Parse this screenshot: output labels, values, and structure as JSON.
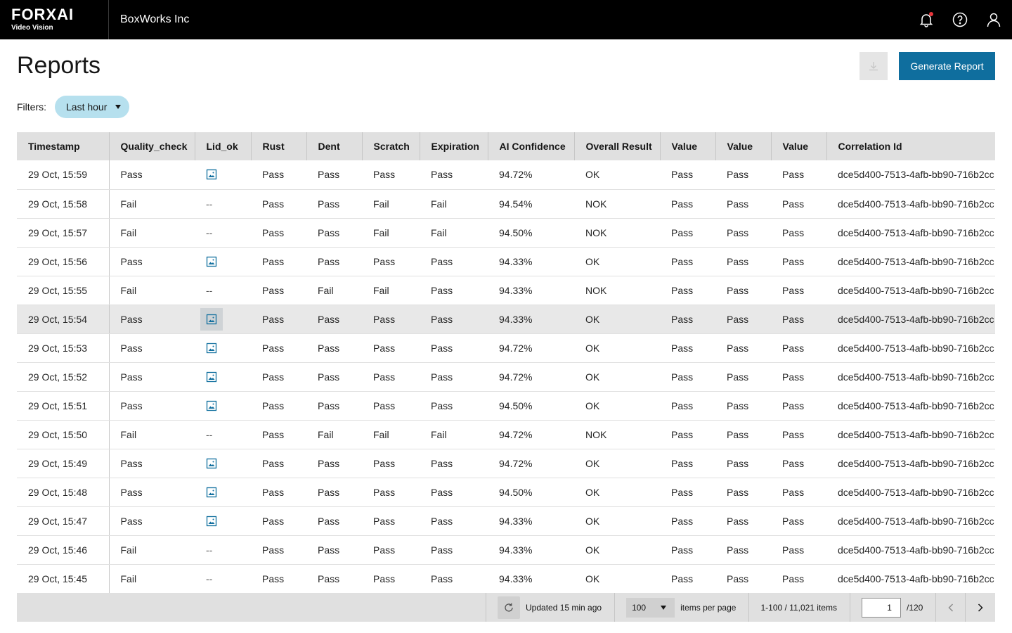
{
  "header": {
    "brand_name": "FORXAI",
    "brand_sub": "Video Vision",
    "company": "BoxWorks Inc",
    "icons": [
      "bell-icon",
      "help-icon",
      "user-icon"
    ]
  },
  "page": {
    "title": "Reports",
    "generate_label": "Generate Report",
    "download_icon": "download-icon"
  },
  "filters": {
    "label": "Filters:",
    "chip_label": "Last hour"
  },
  "colors": {
    "primary": "#0f6e9e",
    "chip": "#b6e0ee",
    "header_bg": "#000000",
    "notification": "#e8353b"
  },
  "table": {
    "columns": [
      "Timestamp",
      "Quality_check",
      "Lid_ok",
      "Rust",
      "Dent",
      "Scratch",
      "Expiration",
      "AI Confidence",
      "Overall Result",
      "Value",
      "Value",
      "Value",
      "Correlation Id"
    ],
    "rows": [
      {
        "ts": "29 Oct, 15:59",
        "qc": "Pass",
        "lid": "image",
        "rust": "Pass",
        "dent": "Pass",
        "scratch": "Pass",
        "exp": "Pass",
        "ai": "94.72%",
        "overall": "OK",
        "v1": "Pass",
        "v2": "Pass",
        "v3": "Pass",
        "cid": "dce5d400-7513-4afb-bb90-716b2cc"
      },
      {
        "ts": "29 Oct, 15:58",
        "qc": "Fail",
        "lid": "--",
        "rust": "Pass",
        "dent": "Pass",
        "scratch": "Fail",
        "exp": "Fail",
        "ai": "94.54%",
        "overall": "NOK",
        "v1": "Pass",
        "v2": "Pass",
        "v3": "Pass",
        "cid": "dce5d400-7513-4afb-bb90-716b2cc"
      },
      {
        "ts": "29 Oct, 15:57",
        "qc": "Fail",
        "lid": "--",
        "rust": "Pass",
        "dent": "Pass",
        "scratch": "Fail",
        "exp": "Fail",
        "ai": "94.50%",
        "overall": "NOK",
        "v1": "Pass",
        "v2": "Pass",
        "v3": "Pass",
        "cid": "dce5d400-7513-4afb-bb90-716b2cc"
      },
      {
        "ts": "29 Oct, 15:56",
        "qc": "Pass",
        "lid": "image",
        "rust": "Pass",
        "dent": "Pass",
        "scratch": "Pass",
        "exp": "Pass",
        "ai": "94.33%",
        "overall": "OK",
        "v1": "Pass",
        "v2": "Pass",
        "v3": "Pass",
        "cid": "dce5d400-7513-4afb-bb90-716b2cc"
      },
      {
        "ts": "29 Oct, 15:55",
        "qc": "Fail",
        "lid": "--",
        "rust": "Pass",
        "dent": "Fail",
        "scratch": "Fail",
        "exp": "Pass",
        "ai": "94.33%",
        "overall": "NOK",
        "v1": "Pass",
        "v2": "Pass",
        "v3": "Pass",
        "cid": "dce5d400-7513-4afb-bb90-716b2cc"
      },
      {
        "ts": "29 Oct, 15:54",
        "qc": "Pass",
        "lid": "image",
        "rust": "Pass",
        "dent": "Pass",
        "scratch": "Pass",
        "exp": "Pass",
        "ai": "94.33%",
        "overall": "OK",
        "v1": "Pass",
        "v2": "Pass",
        "v3": "Pass",
        "cid": "dce5d400-7513-4afb-bb90-716b2cc",
        "hover": true
      },
      {
        "ts": "29 Oct, 15:53",
        "qc": "Pass",
        "lid": "image",
        "rust": "Pass",
        "dent": "Pass",
        "scratch": "Pass",
        "exp": "Pass",
        "ai": "94.72%",
        "overall": "OK",
        "v1": "Pass",
        "v2": "Pass",
        "v3": "Pass",
        "cid": "dce5d400-7513-4afb-bb90-716b2cc"
      },
      {
        "ts": "29 Oct, 15:52",
        "qc": "Pass",
        "lid": "image",
        "rust": "Pass",
        "dent": "Pass",
        "scratch": "Pass",
        "exp": "Pass",
        "ai": "94.72%",
        "overall": "OK",
        "v1": "Pass",
        "v2": "Pass",
        "v3": "Pass",
        "cid": "dce5d400-7513-4afb-bb90-716b2cc"
      },
      {
        "ts": "29 Oct, 15:51",
        "qc": "Pass",
        "lid": "image",
        "rust": "Pass",
        "dent": "Pass",
        "scratch": "Pass",
        "exp": "Pass",
        "ai": "94.50%",
        "overall": "OK",
        "v1": "Pass",
        "v2": "Pass",
        "v3": "Pass",
        "cid": "dce5d400-7513-4afb-bb90-716b2cc"
      },
      {
        "ts": "29 Oct, 15:50",
        "qc": "Fail",
        "lid": "--",
        "rust": "Pass",
        "dent": "Fail",
        "scratch": "Fail",
        "exp": "Fail",
        "ai": "94.72%",
        "overall": "NOK",
        "v1": "Pass",
        "v2": "Pass",
        "v3": "Pass",
        "cid": "dce5d400-7513-4afb-bb90-716b2cc"
      },
      {
        "ts": "29 Oct, 15:49",
        "qc": "Pass",
        "lid": "image",
        "rust": "Pass",
        "dent": "Pass",
        "scratch": "Pass",
        "exp": "Pass",
        "ai": "94.72%",
        "overall": "OK",
        "v1": "Pass",
        "v2": "Pass",
        "v3": "Pass",
        "cid": "dce5d400-7513-4afb-bb90-716b2cc"
      },
      {
        "ts": "29 Oct, 15:48",
        "qc": "Pass",
        "lid": "image",
        "rust": "Pass",
        "dent": "Pass",
        "scratch": "Pass",
        "exp": "Pass",
        "ai": "94.50%",
        "overall": "OK",
        "v1": "Pass",
        "v2": "Pass",
        "v3": "Pass",
        "cid": "dce5d400-7513-4afb-bb90-716b2cc"
      },
      {
        "ts": "29 Oct, 15:47",
        "qc": "Pass",
        "lid": "image",
        "rust": "Pass",
        "dent": "Pass",
        "scratch": "Pass",
        "exp": "Pass",
        "ai": "94.33%",
        "overall": "OK",
        "v1": "Pass",
        "v2": "Pass",
        "v3": "Pass",
        "cid": "dce5d400-7513-4afb-bb90-716b2cc"
      },
      {
        "ts": "29 Oct, 15:46",
        "qc": "Fail",
        "lid": "--",
        "rust": "Pass",
        "dent": "Pass",
        "scratch": "Pass",
        "exp": "Pass",
        "ai": "94.33%",
        "overall": "OK",
        "v1": "Pass",
        "v2": "Pass",
        "v3": "Pass",
        "cid": "dce5d400-7513-4afb-bb90-716b2cc"
      },
      {
        "ts": "29 Oct, 15:45",
        "qc": "Fail",
        "lid": "--",
        "rust": "Pass",
        "dent": "Pass",
        "scratch": "Pass",
        "exp": "Pass",
        "ai": "94.33%",
        "overall": "OK",
        "v1": "Pass",
        "v2": "Pass",
        "v3": "Pass",
        "cid": "dce5d400-7513-4afb-bb90-716b2cc"
      }
    ]
  },
  "pagination": {
    "updated_text": "Updated 15 min ago",
    "per_page_value": "100",
    "per_page_label": "items per page",
    "range_text": "1-100 / 11,021 items",
    "page_value": "1",
    "page_total": "/120"
  }
}
